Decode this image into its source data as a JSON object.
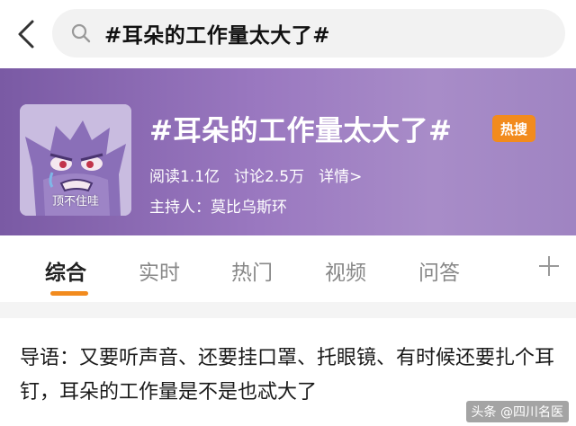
{
  "search": {
    "query": "#耳朵的工作量太大了#"
  },
  "topic": {
    "title": "#耳朵的工作量太大了#",
    "badge": "热搜",
    "avatar_caption": "顶不住哇",
    "stats": {
      "reads": "阅读1.1亿",
      "discussions": "讨论2.5万",
      "details": "详情>"
    },
    "host": "主持人：莫比乌斯环"
  },
  "tabs": [
    {
      "label": "综合",
      "active": true
    },
    {
      "label": "实时",
      "active": false
    },
    {
      "label": "热门",
      "active": false
    },
    {
      "label": "视频",
      "active": false
    },
    {
      "label": "问答",
      "active": false
    }
  ],
  "guide": {
    "text": "导语：又要听声音、还要挂口罩、托眼镜、有时候还要扎个耳钉，耳朵的工作量是不是也忒大了"
  },
  "watermark": "头条 @四川名医",
  "colors": {
    "accent": "#f28b1e",
    "banner": "#9a78c0"
  },
  "icons": {
    "back": "chevron-left-icon",
    "search": "search-icon",
    "add": "plus-icon"
  }
}
